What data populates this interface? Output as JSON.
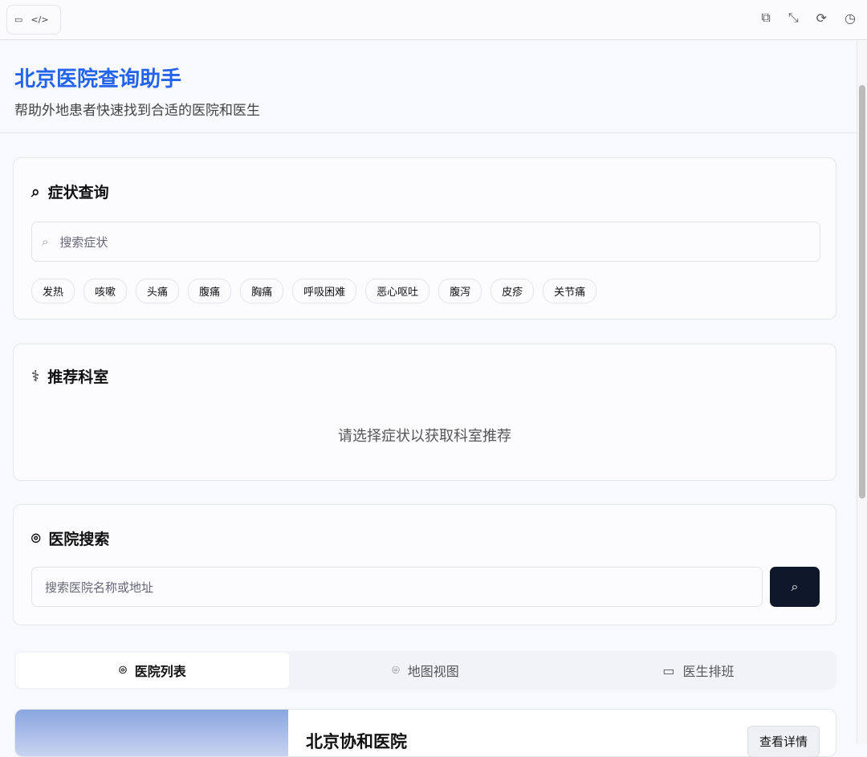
{
  "header": {
    "title": "北京医院查询助手",
    "subtitle": "帮助外地患者快速找到合适的医院和医生"
  },
  "symptom": {
    "title": "症状查询",
    "placeholder": "搜索症状",
    "chips": [
      "发热",
      "咳嗽",
      "头痛",
      "腹痛",
      "胸痛",
      "呼吸困难",
      "恶心呕吐",
      "腹泻",
      "皮疹",
      "关节痛"
    ]
  },
  "department": {
    "title": "推荐科室",
    "empty": "请选择症状以获取科室推荐"
  },
  "hospital_search": {
    "title": "医院搜索",
    "placeholder": "搜索医院名称或地址"
  },
  "tabs": [
    "医院列表",
    "地图视图",
    "医生排班"
  ],
  "hospital": {
    "name": "北京协和医院",
    "detail_label": "查看详情"
  },
  "colors": {
    "accent": "#2463eb",
    "button": "#0f172a"
  }
}
